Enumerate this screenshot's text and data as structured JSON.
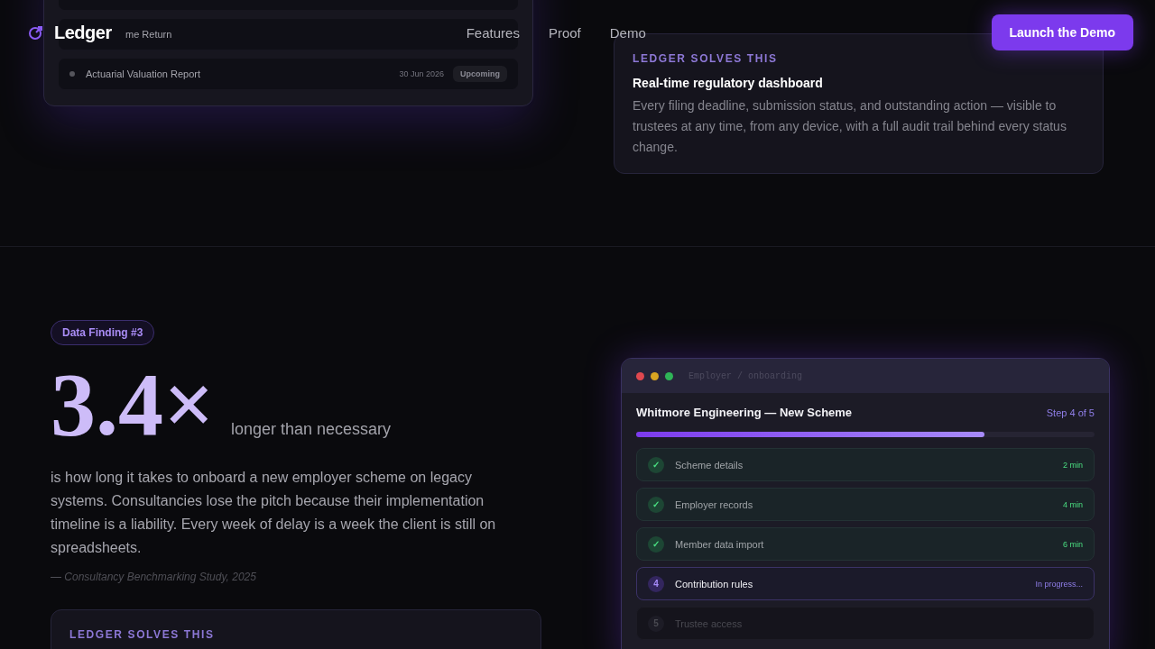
{
  "nav": {
    "brand": "Ledger",
    "links": [
      "Features",
      "Proof",
      "Demo"
    ],
    "cta": "Launch the Demo"
  },
  "filings_preview": {
    "rows": [
      {
        "title": "me Return"
      },
      {
        "title": "Actuarial Valuation Report",
        "date": "30 Jun 2026",
        "badge": "Upcoming"
      }
    ]
  },
  "solution_1": {
    "eyebrow": "LEDGER SOLVES THIS",
    "title": "Real-time regulatory dashboard",
    "body": "Every filing deadline, submission status, and outstanding action — visible to trustees at any time, from any device, with a full audit trail behind every status change."
  },
  "finding": {
    "badge": "Data Finding #3",
    "figure": "3.4×",
    "figure_caption": "longer than necessary",
    "body": "is how long it takes to onboard a new employer scheme on legacy systems. Consultancies lose the pitch because their implementation timeline is a liability. Every week of delay is a week the client is still on spreadsheets.",
    "source": "— Consultancy Benchmarking Study, 2025"
  },
  "solution_2": {
    "eyebrow": "LEDGER SOLVES THIS"
  },
  "onboarding_window": {
    "breadcrumb": "Employer / onboarding",
    "title": "Whitmore Engineering — New Scheme",
    "step_label": "Step 4 of 5",
    "progress": {
      "level": 0.76
    },
    "steps": [
      {
        "marker": "✓",
        "name": "Scheme details",
        "status": "2 min",
        "completed": true,
        "current": false
      },
      {
        "marker": "✓",
        "name": "Employer records",
        "status": "4 min",
        "completed": true,
        "current": false
      },
      {
        "marker": "✓",
        "name": "Member data import",
        "status": "6 min",
        "completed": true,
        "current": false
      },
      {
        "marker": "4",
        "name": "Contribution rules",
        "status": "In progress...",
        "completed": false,
        "current": true
      },
      {
        "marker": "5",
        "name": "Trustee access",
        "completed": false,
        "current": false
      }
    ]
  }
}
